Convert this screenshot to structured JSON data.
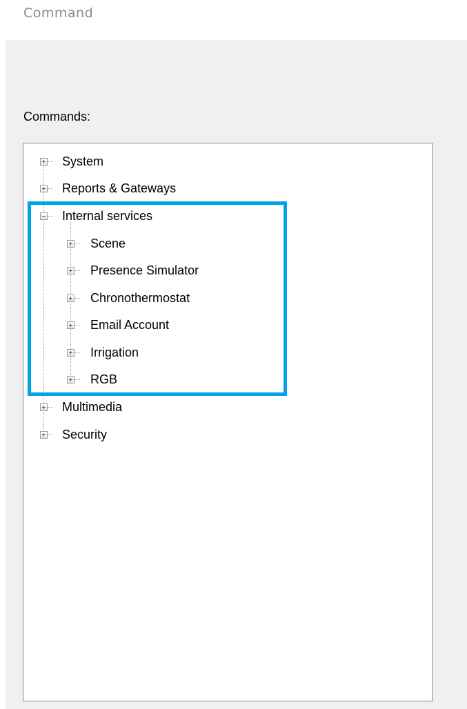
{
  "window": {
    "title": "Command"
  },
  "commands_label": "Commands:",
  "tree": {
    "nodes": [
      {
        "label": "System",
        "state": "collapsed"
      },
      {
        "label": "Reports & Gateways",
        "state": "collapsed"
      },
      {
        "label": "Internal services",
        "state": "expanded",
        "children": [
          {
            "label": "Scene",
            "state": "collapsed"
          },
          {
            "label": "Presence Simulator",
            "state": "collapsed"
          },
          {
            "label": "Chronothermostat",
            "state": "collapsed"
          },
          {
            "label": "Email Account",
            "state": "collapsed"
          },
          {
            "label": "Irrigation",
            "state": "collapsed"
          },
          {
            "label": "RGB",
            "state": "collapsed"
          }
        ]
      },
      {
        "label": "Multimedia",
        "state": "collapsed"
      },
      {
        "label": "Security",
        "state": "collapsed"
      }
    ]
  },
  "colors": {
    "highlight": "#00a3e8",
    "panel_background": "#f0f0f0",
    "expander_glyph": "#3c4fa0"
  }
}
